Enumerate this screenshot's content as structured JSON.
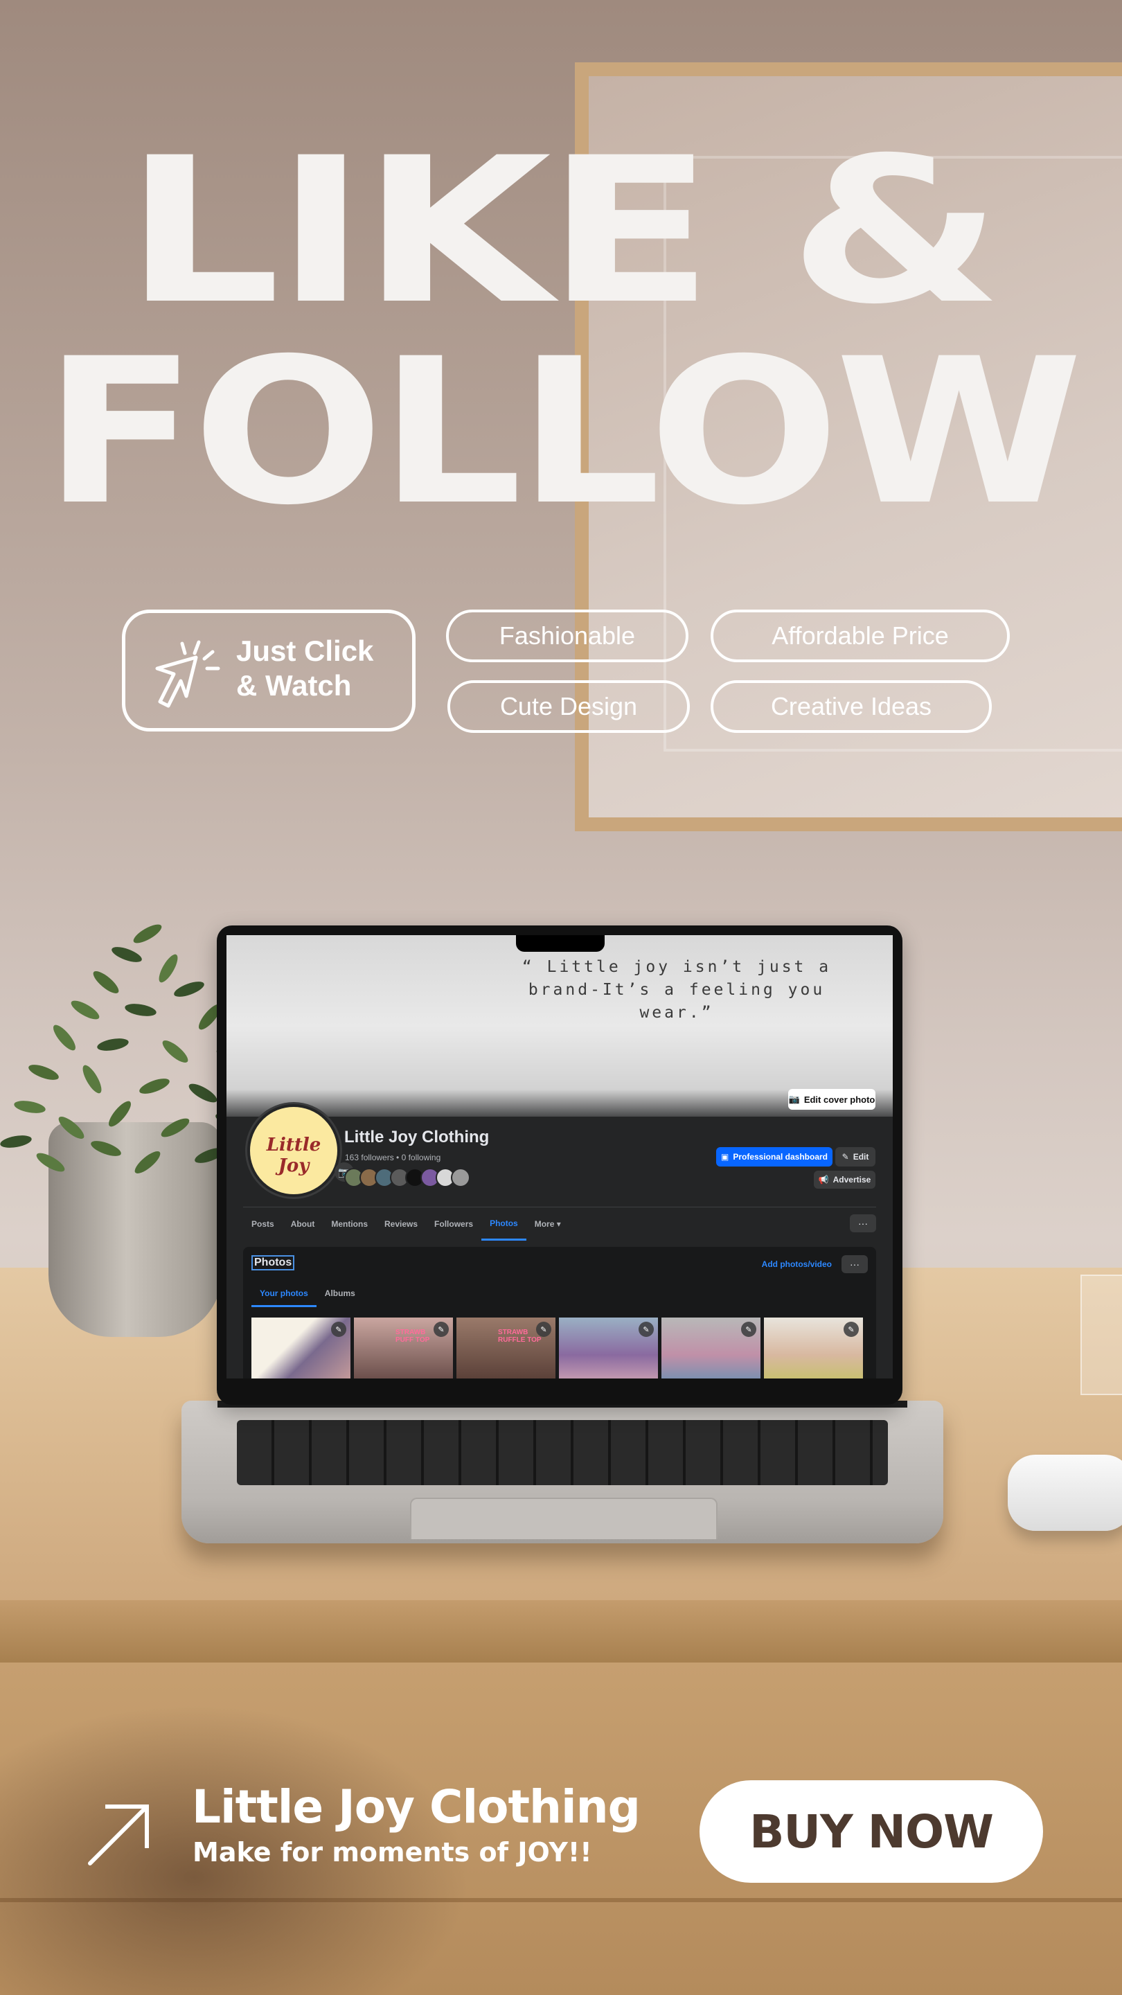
{
  "headline": {
    "line1": "LIKE &",
    "line2": "FOLLOW"
  },
  "click_box": {
    "line1": "Just Click",
    "line2": "& Watch",
    "icon": "cursor-click-icon"
  },
  "features": [
    "Fashionable",
    "Affordable Price",
    "Cute Design",
    "Creative Ideas"
  ],
  "facebook": {
    "cover_quote": "“ Little joy isn’t just a brand-It’s a feeling you wear.”",
    "edit_cover_label": "Edit cover photo",
    "avatar_logo": "Little Joy",
    "page_name": "Little Joy Clothing",
    "stats": "163 followers • 0 following",
    "professional_dashboard_label": "Professional dashboard",
    "edit_label": "Edit",
    "advertise_label": "Advertise",
    "tabs": [
      "Posts",
      "About",
      "Mentions",
      "Reviews",
      "Followers",
      "Photos",
      "More ▾"
    ],
    "active_tab": "Photos",
    "more_label": "···",
    "photos_title": "Photos",
    "add_photos_label": "Add photos/video",
    "sub_tabs": [
      "Your photos",
      "Albums"
    ],
    "thumb_labels": [
      "",
      "STRAWB PUFF TOP",
      "STRAWB RUFFLE TOP",
      "",
      "",
      ""
    ]
  },
  "footer": {
    "brand": "Little Joy Clothing",
    "tagline": "Make for moments of JOY!!",
    "cta": "BUY NOW"
  },
  "colors": {
    "fb_blue": "#0866ff",
    "fb_dark": "#242526",
    "cta_text": "#4d3a2f",
    "headline": "#f4f2f0"
  }
}
